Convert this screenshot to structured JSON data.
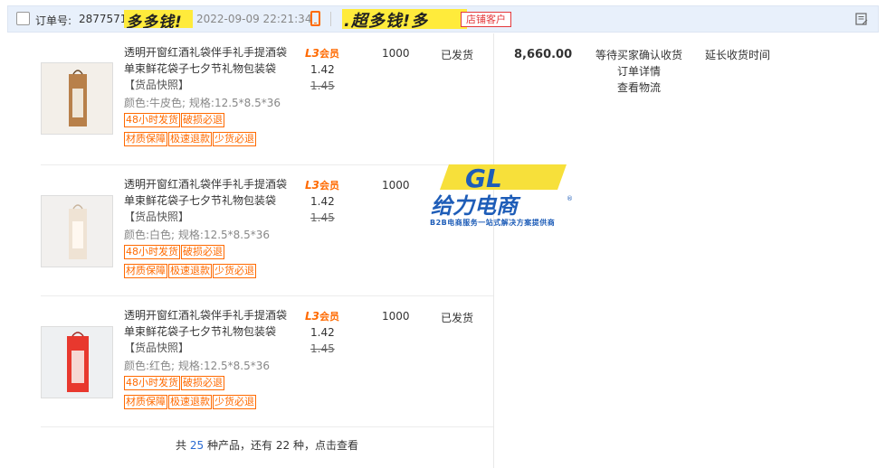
{
  "header": {
    "order_label": "订单号:",
    "order_number": "28775717",
    "redaction_text_1": "多多钱!",
    "order_time": "2022-09-09 22:21:34",
    "redaction_text_2": ".超多钱!多",
    "store_badge": "店铺客户"
  },
  "products": [
    {
      "title": "透明开窗红酒礼袋伴手礼手提酒袋单束鲜花袋子七夕节礼物包装袋",
      "snapshot": "【货品快照】",
      "spec": "颜色:牛皮色;  规格:12.5*8.5*36",
      "tags": [
        "48小时发货",
        "破损必退",
        "材质保障",
        "极速退款",
        "少货必退"
      ],
      "member_level": "L3",
      "member_text": "会员",
      "price": "1.42",
      "original_price": "1.45",
      "quantity": "1000",
      "status": "已发货",
      "swatch": "#b8804a"
    },
    {
      "title": "透明开窗红酒礼袋伴手礼手提酒袋单束鲜花袋子七夕节礼物包装袋",
      "snapshot": "【货品快照】",
      "spec": "颜色:白色;  规格:12.5*8.5*36",
      "tags": [
        "48小时发货",
        "破损必退",
        "材质保障",
        "极速退款",
        "少货必退"
      ],
      "member_level": "L3",
      "member_text": "会员",
      "price": "1.42",
      "original_price": "1.45",
      "quantity": "1000",
      "status": "",
      "swatch": "#efe3d4"
    },
    {
      "title": "透明开窗红酒礼袋伴手礼手提酒袋单束鲜花袋子七夕节礼物包装袋",
      "snapshot": "【货品快照】",
      "spec": "颜色:红色;  规格:12.5*8.5*36",
      "tags": [
        "48小时发货",
        "破损必退",
        "材质保障",
        "极速退款",
        "少货必退"
      ],
      "member_level": "L3",
      "member_text": "会员",
      "price": "1.42",
      "original_price": "1.45",
      "quantity": "1000",
      "status": "已发货",
      "swatch": "#e8382e"
    }
  ],
  "order": {
    "total": "8,660.00",
    "state": "等待买家确认收货",
    "detail_link": "订单详情",
    "logistics_link": "查看物流",
    "extend_link": "延长收货时间"
  },
  "footer": {
    "prefix": "共",
    "total_kinds": "25",
    "middle": "种产品，还有",
    "more_kinds": "22",
    "suffix": "种，点击查看"
  },
  "watermark": {
    "logo": "GL",
    "name": "给力电商",
    "tagline": "B2B电商服务一站式解决方案提供商"
  },
  "colors": {
    "accent": "#ff6a00",
    "header_bg": "#e8f0fb",
    "badge": "#e4393c",
    "link_blue": "#2a6ad1"
  }
}
